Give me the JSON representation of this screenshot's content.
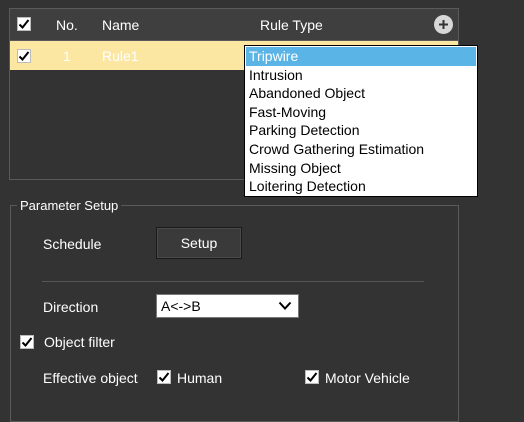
{
  "rules_table": {
    "columns": {
      "no": "No.",
      "name": "Name",
      "rule_type": "Rule Type"
    },
    "rows": [
      {
        "checked": true,
        "no": "1",
        "name": "Rule1"
      }
    ]
  },
  "rule_type_options": [
    "Tripwire",
    "Intrusion",
    "Abandoned Object",
    "Fast-Moving",
    "Parking Detection",
    "Crowd Gathering Estimation",
    "Missing Object",
    "Loitering Detection"
  ],
  "rule_type_selected": "Tripwire",
  "parameter_setup": {
    "title": "Parameter Setup",
    "schedule_label": "Schedule",
    "setup_button": "Setup",
    "direction_label": "Direction",
    "direction_value": "A<->B",
    "object_filter_label": "Object filter",
    "object_filter_checked": true,
    "effective_object_label": "Effective object",
    "human_label": "Human",
    "human_checked": true,
    "motor_vehicle_label": "Motor Vehicle",
    "motor_vehicle_checked": true
  },
  "colors": {
    "selected_row": "#fbe7a2",
    "selected_option": "#5bb4e6",
    "background": "#333333"
  }
}
